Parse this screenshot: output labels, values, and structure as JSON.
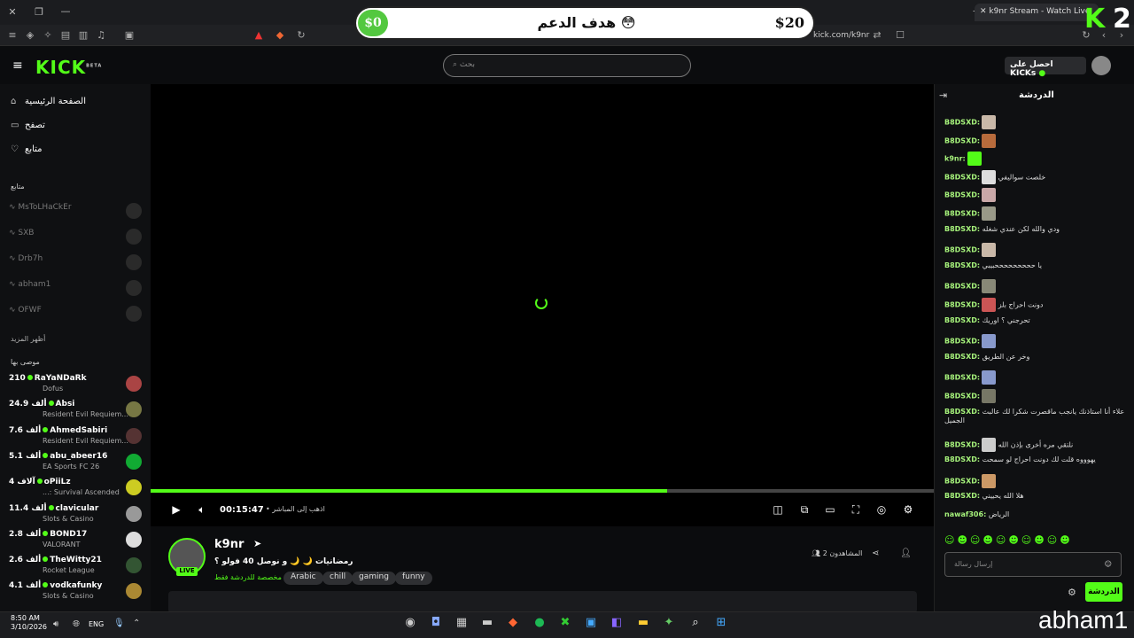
{
  "browser": {
    "tab_title": "k9nr Stream - Watch Live",
    "url": "kick.com/k9nr"
  },
  "goal": {
    "left_amount": "$0",
    "title": "هدف الدعم 😳",
    "right_amount": "$20"
  },
  "header": {
    "logo": "KICK",
    "logo_badge": "BETA",
    "search_placeholder": "بحث",
    "kicks_button": "احصل على KICKs"
  },
  "sidebar": {
    "nav": [
      {
        "label": "الصفحة الرئيسية",
        "icon": "home-icon"
      },
      {
        "label": "تصفح",
        "icon": "browse-icon"
      },
      {
        "label": "متابع",
        "icon": "heart-icon"
      }
    ],
    "following_title": "متابع",
    "following": [
      "MsToLHaCkEr",
      "SXB",
      "Drb7h",
      "abham1",
      "OFWF"
    ],
    "show_more": "أظهر المزيد",
    "recommended_title": "موصى بها",
    "recommended": [
      {
        "name": "RaYaNDaRk",
        "count": "210",
        "category": "Dofus",
        "color": "#a44"
      },
      {
        "name": "Absi",
        "count": "24.9 ألف",
        "category": "Resident Evil Requiem...",
        "color": "#774"
      },
      {
        "name": "AhmedSabiri",
        "count": "7.6 ألف",
        "category": "Resident Evil Requiem...",
        "color": "#533"
      },
      {
        "name": "abu_abeer16",
        "count": "5.1 ألف",
        "category": "EA Sports FC 26",
        "color": "#1a3"
      },
      {
        "name": "oPiiLz",
        "count": "4 آلاف",
        "category": "...: Survival Ascended",
        "color": "#cc2"
      },
      {
        "name": "clavicular",
        "count": "11.4 ألف",
        "category": "Slots & Casino",
        "color": "#999"
      },
      {
        "name": "BOND17",
        "count": "2.8 ألف",
        "category": "VALORANT",
        "color": "#ddd"
      },
      {
        "name": "TheWitty21",
        "count": "2.6 ألف",
        "category": "Rocket League",
        "color": "#353"
      },
      {
        "name": "vodkafunky",
        "count": "4.1 ألف",
        "category": "Slots & Casino",
        "color": "#a83"
      }
    ]
  },
  "player": {
    "time": "00:15:47",
    "go_live": "اذهب إلى المباشر",
    "progress_fraction": 0.66
  },
  "stream": {
    "streamer": "k9nr",
    "live_badge": "LIVE",
    "title": "رمضانيات 🌙 🌙 و نوصل 40 فولو ؟",
    "chat_mode": "مخصصة للدردشة فقط",
    "tags": [
      "Arabic",
      "chill",
      "gaming",
      "funny"
    ],
    "viewers": "2 المشاهدون"
  },
  "chat": {
    "title": "الدردشة",
    "messages": [
      {
        "user": "B8DSXD:",
        "text": "",
        "badge": "#c9b8a8"
      },
      {
        "user": "B8DSXD:",
        "text": "",
        "badge": "#b86b3c"
      },
      {
        "user": "k9nr:",
        "text": "",
        "badge": "#53fc18"
      },
      {
        "user": "B8DSXD:",
        "text": "خلصت سواليفي",
        "badge": "#ddd"
      },
      {
        "user": "B8DSXD:",
        "text": "",
        "badge": "#c9a8a8"
      },
      {
        "user": "B8DSXD:",
        "text": "",
        "badge": "#998"
      },
      {
        "user": "B8DSXD:",
        "text": "ودي والله لكن عندي شغله",
        "badge": ""
      },
      {
        "user": "B8DSXD:",
        "text": "",
        "badge": "#c9b8a8"
      },
      {
        "user": "B8DSXD:",
        "text": "يا حححححححححبيبي",
        "badge": ""
      },
      {
        "user": "B8DSXD:",
        "text": "",
        "badge": "#887"
      },
      {
        "user": "B8DSXD:",
        "text": "دونت احراج بلز",
        "badge": "#c55"
      },
      {
        "user": "B8DSXD:",
        "text": "تحرجني ؟ اوريك",
        "badge": ""
      },
      {
        "user": "B8DSXD:",
        "text": "",
        "badge": "#89c"
      },
      {
        "user": "B8DSXD:",
        "text": "وخر عن الطريق",
        "badge": ""
      },
      {
        "user": "B8DSXD:",
        "text": "",
        "badge": "#89c"
      },
      {
        "user": "B8DSXD:",
        "text": "",
        "badge": "#776"
      },
      {
        "user": "B8DSXD:",
        "text": "علاء أنا استاذنك يانجب ماقصرت شكرا لك عالبث الجميل",
        "badge": ""
      },
      {
        "user": "B8DSXD:",
        "text": "نلتقي مره أخرى بإذن الله",
        "badge": "#ccc"
      },
      {
        "user": "B8DSXD:",
        "text": "يهوووه قلت لك دونت احراج لو سمحت",
        "badge": ""
      },
      {
        "user": "B8DSXD:",
        "text": "",
        "badge": "#c96"
      },
      {
        "user": "B8DSXD:",
        "text": "هلا الله يحييني",
        "badge": ""
      },
      {
        "user": "nawaf306:",
        "text": "الرياض",
        "badge": ""
      }
    ],
    "input_placeholder": "إرسال رسالة",
    "send_button": "الدردشة"
  },
  "taskbar": {
    "time": "8:50 AM",
    "date": "3/10/2026",
    "lang": "ENG"
  },
  "watermark": "abham1",
  "brand": {
    "k": "K",
    "num": "2"
  },
  "colors": {
    "accent": "#53fc18"
  }
}
